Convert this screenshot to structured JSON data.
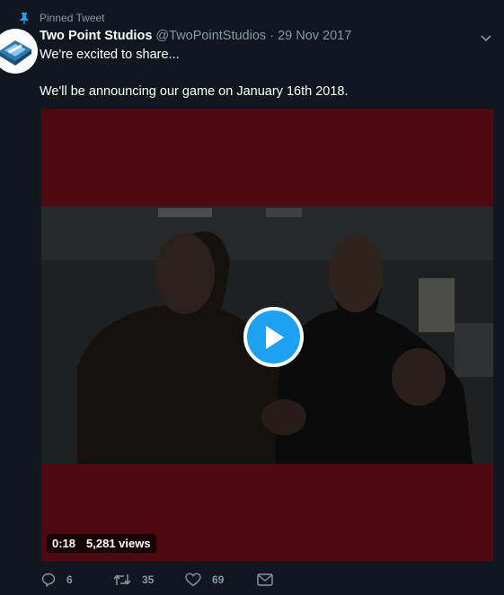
{
  "pinned": {
    "label": "Pinned Tweet"
  },
  "author": {
    "display_name": "Two Point Studios",
    "handle": "@TwoPointStudios",
    "separator": "·",
    "timestamp": "29 Nov 2017"
  },
  "tweet": {
    "line1": "We're excited to share...",
    "line2": "We'll be announcing our game on January 16th 2018."
  },
  "video": {
    "duration": "0:18",
    "views": "5,281 views"
  },
  "actions": {
    "replies": "6",
    "retweets": "35",
    "likes": "69"
  },
  "icons": {
    "pin": "pin-icon",
    "chevron": "chevron-down-icon",
    "play": "play-icon",
    "reply": "reply-icon",
    "retweet": "retweet-icon",
    "like": "heart-icon",
    "message": "envelope-icon"
  },
  "colors": {
    "background": "#10171e",
    "accent": "#1da1f2",
    "muted": "#8899a6",
    "media_background": "#4e0910"
  }
}
